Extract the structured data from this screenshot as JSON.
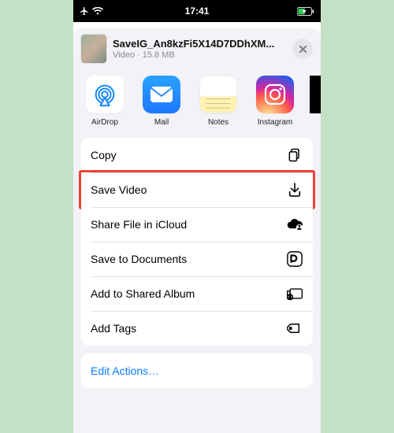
{
  "status": {
    "time": "17:41",
    "battery_charging": true
  },
  "file": {
    "title": "SaveIG_An8kzFi5X14D7DDhXM...",
    "kind": "Video",
    "size": "15.8 MB",
    "subtitle": "Video · 15.8 MB"
  },
  "share_targets": [
    {
      "id": "airdrop",
      "label": "AirDrop"
    },
    {
      "id": "mail",
      "label": "Mail"
    },
    {
      "id": "notes",
      "label": "Notes"
    },
    {
      "id": "instagram",
      "label": "Instagram"
    }
  ],
  "actions": [
    {
      "id": "copy",
      "label": "Copy"
    },
    {
      "id": "save-video",
      "label": "Save Video",
      "highlighted": true
    },
    {
      "id": "share-icloud",
      "label": "Share File in iCloud"
    },
    {
      "id": "save-docs",
      "label": "Save to Documents"
    },
    {
      "id": "shared-album",
      "label": "Add to Shared Album"
    },
    {
      "id": "add-tags",
      "label": "Add Tags"
    }
  ],
  "edit_actions_label": "Edit Actions…"
}
